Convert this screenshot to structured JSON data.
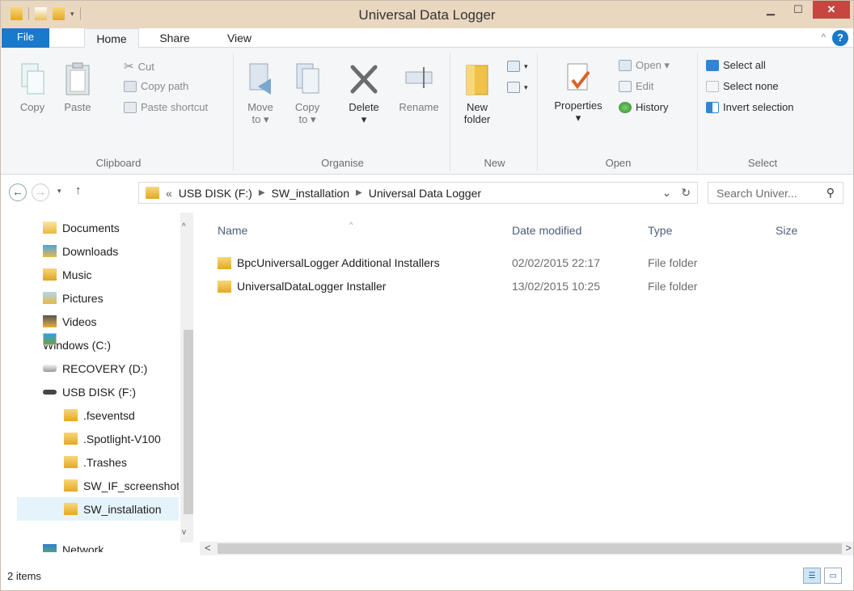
{
  "window": {
    "title": "Universal Data Logger"
  },
  "ribbon_tabs": [
    "File",
    "Home",
    "Share",
    "View"
  ],
  "ribbon": {
    "clipboard": {
      "title": "Clipboard",
      "copy": "Copy",
      "paste": "Paste",
      "cut": "Cut",
      "copy_path": "Copy path",
      "paste_shortcut": "Paste shortcut"
    },
    "organise": {
      "title": "Organise",
      "move_to": [
        "Move",
        "to ▾"
      ],
      "copy_to": [
        "Copy",
        "to ▾"
      ],
      "delete": "Delete",
      "rename": "Rename"
    },
    "new": {
      "title": "New",
      "new_folder": [
        "New",
        "folder"
      ]
    },
    "open": {
      "title": "Open",
      "properties": "Properties",
      "open": "Open ▾",
      "edit": "Edit",
      "history": "History"
    },
    "select": {
      "title": "Select",
      "select_all": "Select all",
      "select_none": "Select none",
      "invert": "Invert selection"
    }
  },
  "address": {
    "prefix": "«",
    "crumbs": [
      "USB DISK (F:)",
      "SW_installation",
      "Universal Data Logger"
    ]
  },
  "search": {
    "placeholder": "Search Univer..."
  },
  "nav_pane": [
    {
      "label": "Documents",
      "icon": "documents-icon"
    },
    {
      "label": "Downloads",
      "icon": "downloads-icon"
    },
    {
      "label": "Music",
      "icon": "music-icon"
    },
    {
      "label": "Pictures",
      "icon": "pictures-icon"
    },
    {
      "label": "Videos",
      "icon": "videos-icon"
    },
    {
      "label": "Windows (C:)",
      "icon": "drive-icon"
    },
    {
      "label": "RECOVERY (D:)",
      "icon": "drive-icon"
    },
    {
      "label": "USB DISK (F:)",
      "icon": "usb-drive-icon"
    },
    {
      "label": ".fseventsd",
      "icon": "folder-icon"
    },
    {
      "label": ".Spotlight-V100",
      "icon": "folder-icon"
    },
    {
      "label": ".Trashes",
      "icon": "folder-icon"
    },
    {
      "label": "SW_IF_screenshots",
      "icon": "folder-icon"
    },
    {
      "label": "SW_installation",
      "icon": "folder-icon",
      "selected": true
    },
    {
      "label": "Network",
      "icon": "network-icon"
    }
  ],
  "columns": {
    "name": "Name",
    "date": "Date modified",
    "type": "Type",
    "size": "Size"
  },
  "files": [
    {
      "name": "BpcUniversalLogger Additional Installers",
      "date": "02/02/2015 22:17",
      "type": "File folder"
    },
    {
      "name": "UniversalDataLogger Installer",
      "date": "13/02/2015 10:25",
      "type": "File folder"
    }
  ],
  "status": {
    "item_count": "2 items"
  }
}
